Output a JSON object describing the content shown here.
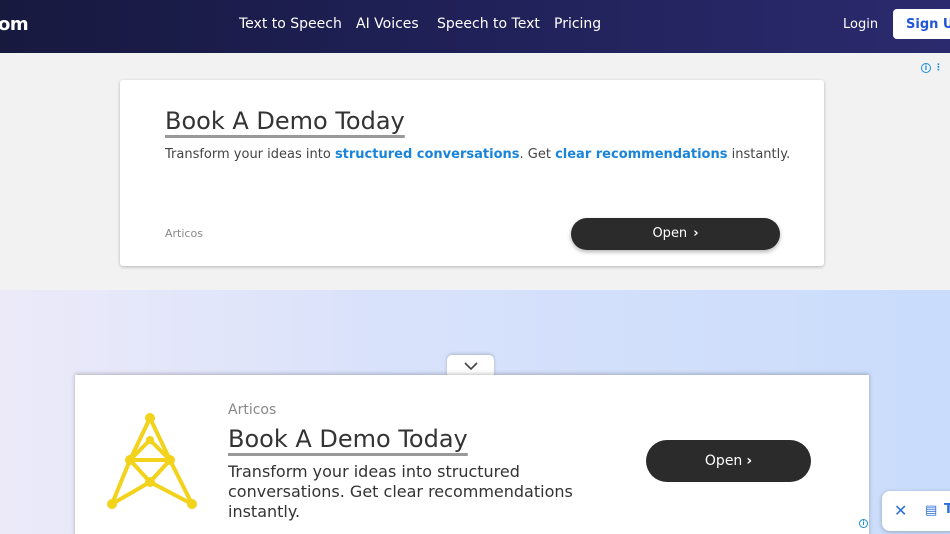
{
  "nav": {
    "brand": "om",
    "links": [
      "Text to Speech",
      "AI Voices",
      "Speech to Text",
      "Pricing"
    ],
    "login": "Login",
    "signup": "Sign Up"
  },
  "ad_info": {
    "icon": "info-icon",
    "menu_icon": "kebab-icon"
  },
  "top_ad": {
    "title": "Book A Demo Today",
    "desc_prefix": "Transform your ideas into ",
    "desc_highlight1": "structured conversations",
    "desc_middle": ". Get ",
    "desc_highlight2": "clear recommendations",
    "desc_suffix": " instantly.",
    "source": "Articos",
    "open_label": "Open",
    "highlight_color": "#1a84d8"
  },
  "bottom_ad": {
    "source": "Articos",
    "title": "Book A Demo Today",
    "description": "Transform your ideas into structured conversations. Get clear recommendations instantly.",
    "open_label": "Open",
    "logo_color": "#f2d21a"
  },
  "float_widget": {
    "letter": "T"
  }
}
